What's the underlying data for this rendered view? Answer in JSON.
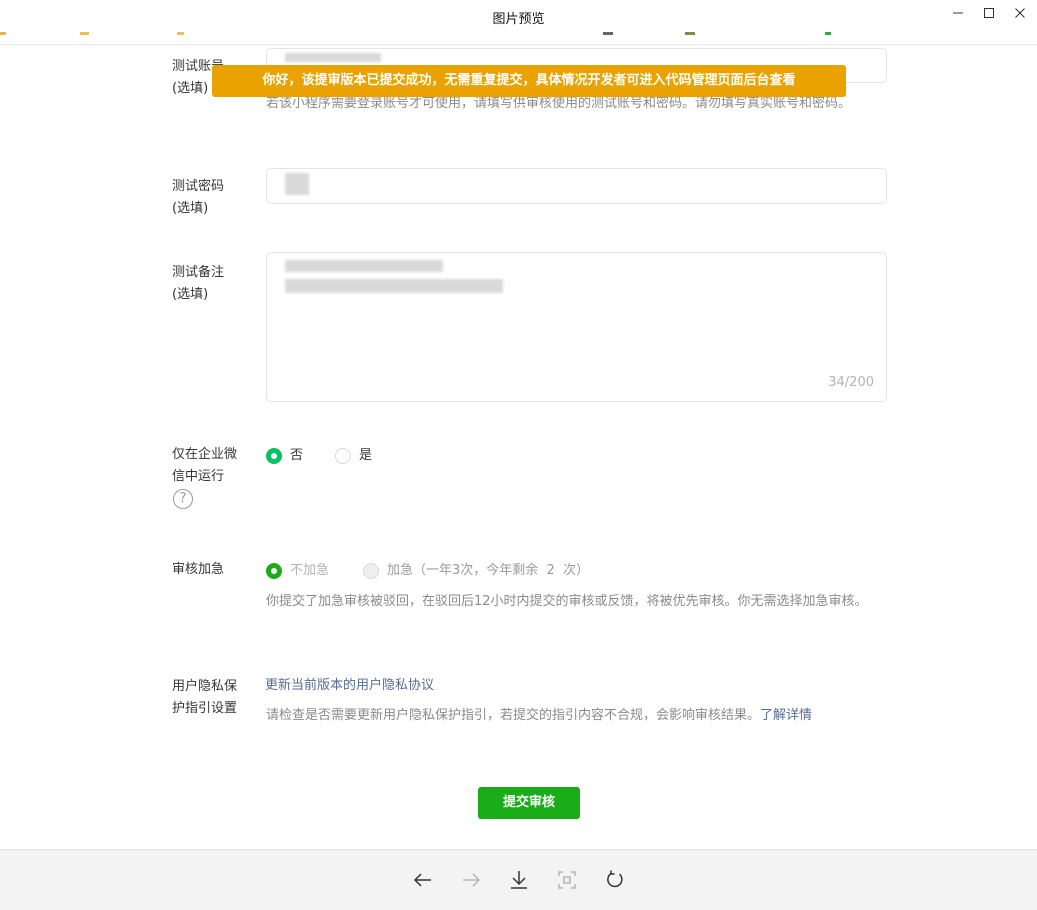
{
  "window": {
    "title": "图片预览"
  },
  "toast": {
    "message": "你好，该提审版本已提交成功，无需重复提交，具体情况开发者可进入代码管理页面后台查看"
  },
  "form": {
    "test_account": {
      "label_line1": "测试账号",
      "label_line2": "(选填)",
      "hint": "若该小程序需要登录账号才可使用，请填写供审核使用的测试账号和密码。请勿填写真实账号和密码。"
    },
    "test_password": {
      "label_line1": "测试密码",
      "label_line2": "(选填)"
    },
    "test_notes": {
      "label_line1": "测试备注",
      "label_line2": "(选填)",
      "counter": "34/200"
    },
    "wecom_only": {
      "label_line1": "仅在企业微",
      "label_line2": "信中运行",
      "help_icon_text": "?",
      "options": [
        {
          "label": "否",
          "selected": true
        },
        {
          "label": "是",
          "selected": false
        }
      ]
    },
    "expedite": {
      "label": "审核加急",
      "options": [
        {
          "label": "不加急",
          "selected": true
        },
        {
          "label": "加急（一年3次，今年剩余  2  次）",
          "selected": false,
          "disabled": true
        }
      ],
      "hint": "你提交了加急审核被驳回，在驳回后12小时内提交的审核或反馈，将被优先审核。你无需选择加急审核。"
    },
    "privacy": {
      "label_line1": "用户隐私保",
      "label_line2": "护指引设置",
      "update_link": "更新当前版本的用户隐私协议",
      "hint": "请检查是否需要更新用户隐私保护指引，若提交的指引内容不合规，会影响审核结果。",
      "more_link": "了解详情"
    }
  },
  "actions": {
    "submit_label": "提交审核"
  },
  "colors": {
    "accent_green": "#07c160",
    "button_green": "#1aad19",
    "toast_orange": "#eaa200",
    "link_blue": "#576b95"
  }
}
